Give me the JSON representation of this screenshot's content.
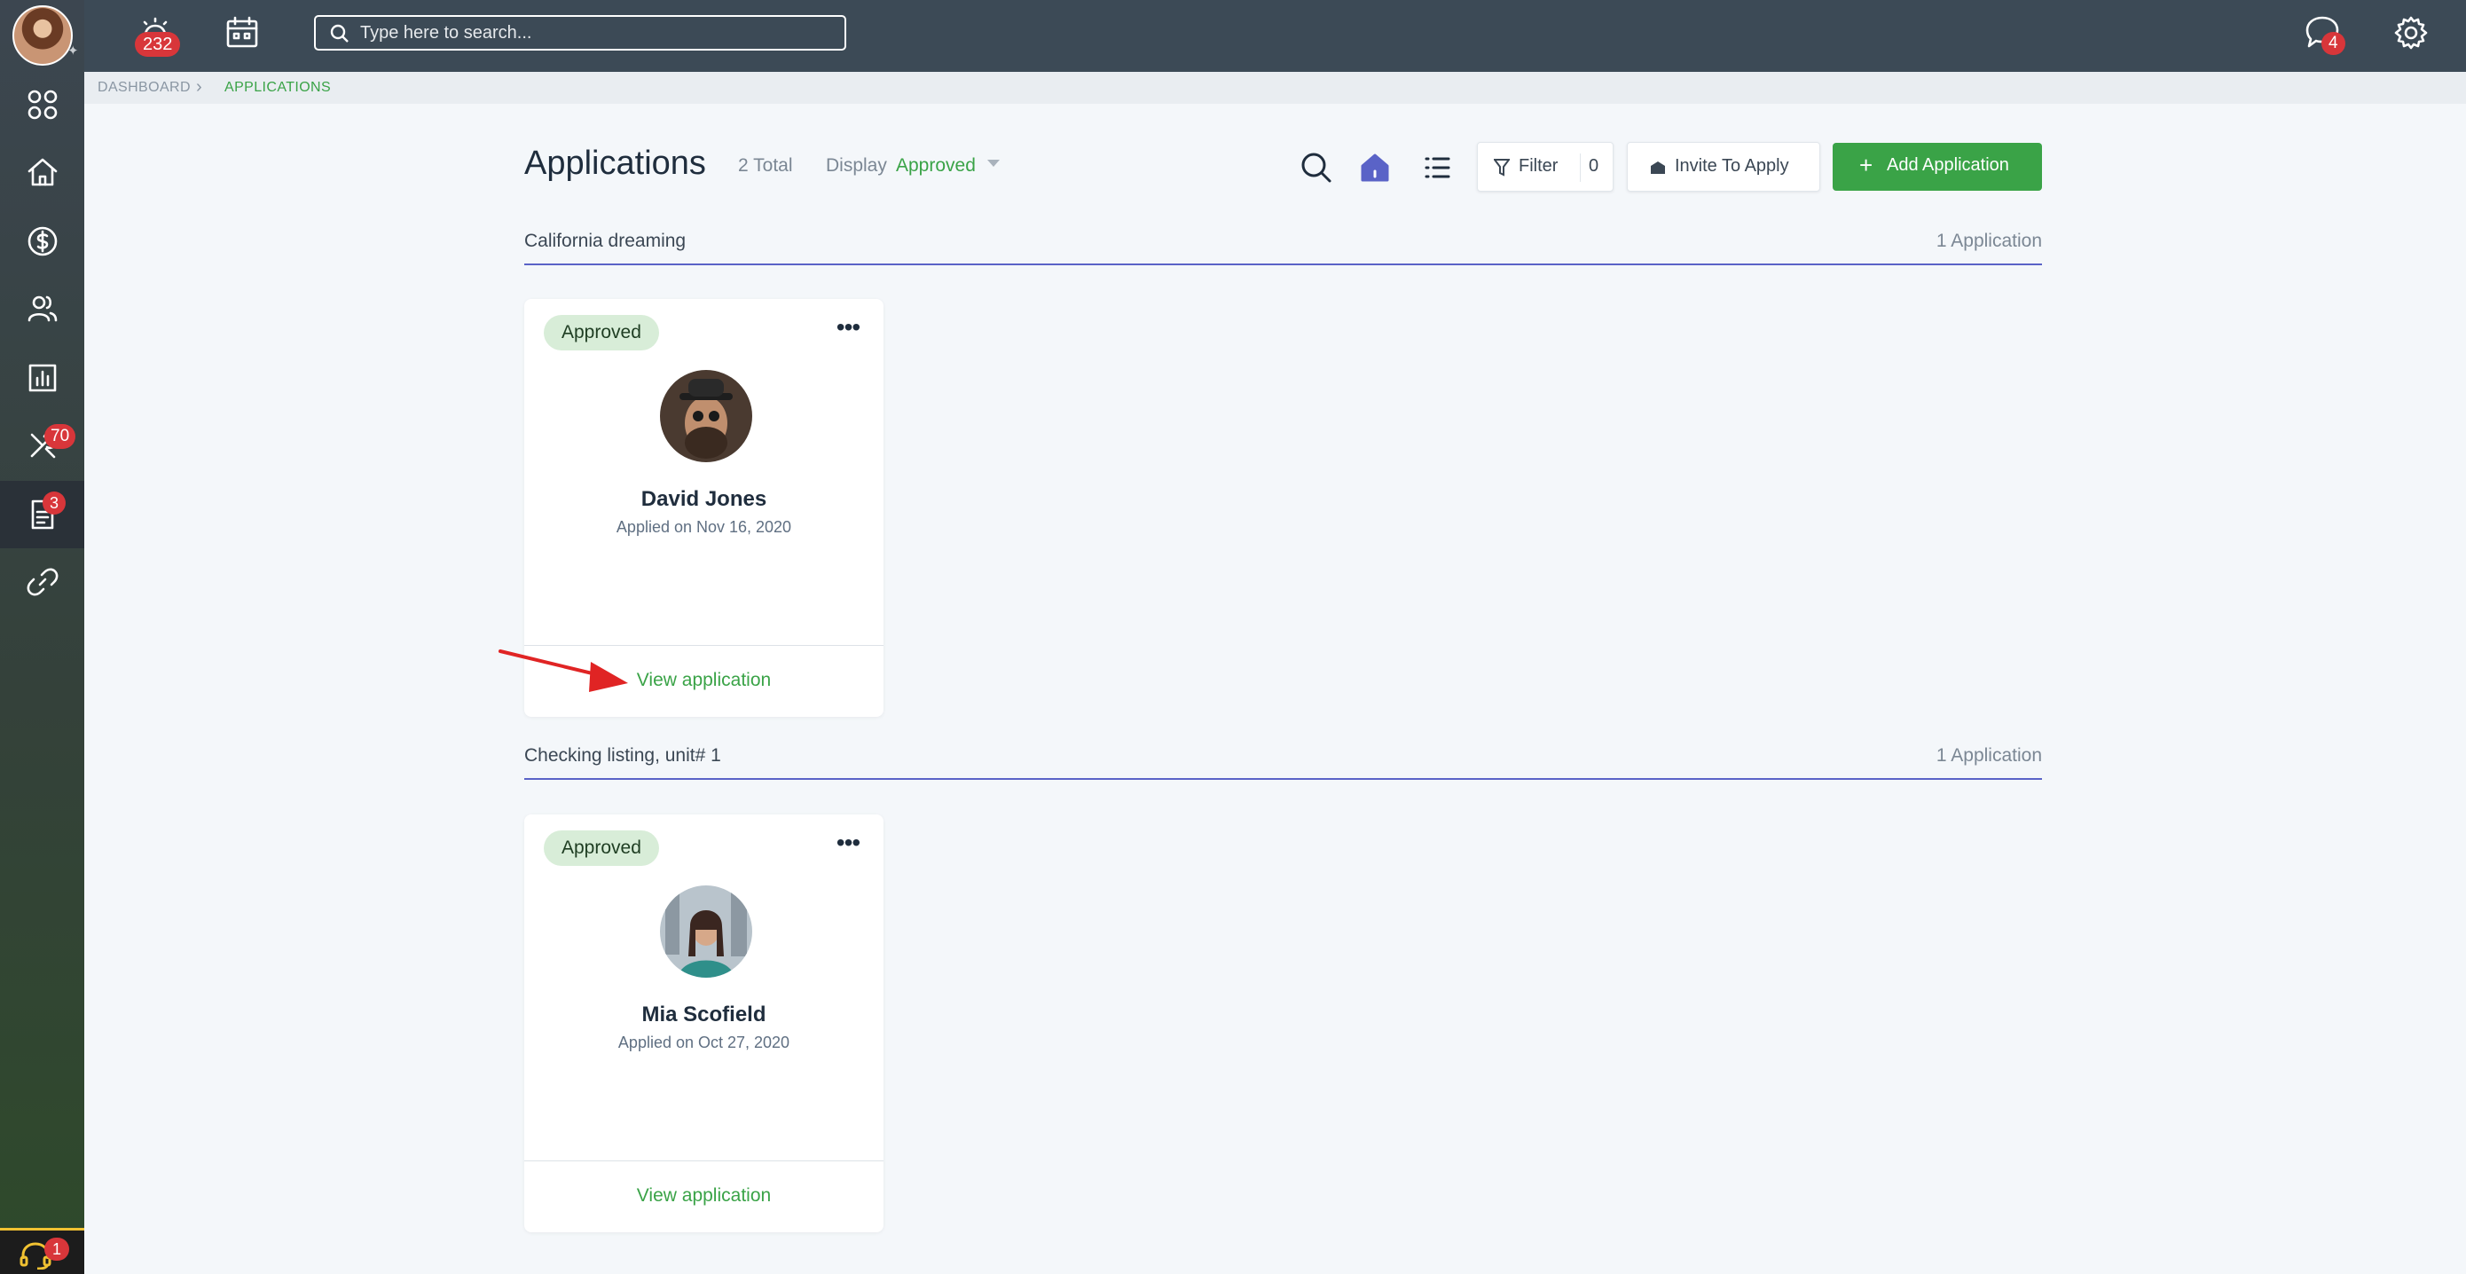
{
  "topbar": {
    "alerts_badge": "232",
    "search_placeholder": "Type here to search...",
    "messages_badge": "4"
  },
  "sidebar": {
    "badges": {
      "maintenance": "70",
      "applications": "3",
      "support": "1"
    }
  },
  "breadcrumb": {
    "dashboard": "DASHBOARD",
    "current": "APPLICATIONS"
  },
  "header": {
    "title": "Applications",
    "total": "2 Total",
    "display_label": "Display",
    "display_value": "Approved",
    "filter_label": "Filter",
    "filter_count": "0",
    "invite_label": "Invite To Apply",
    "add_label": "Add Application"
  },
  "groups": [
    {
      "title": "California dreaming",
      "count": "1 Application",
      "card": {
        "status": "Approved",
        "name": "David Jones",
        "applied": "Applied on Nov 16, 2020",
        "link": "View application"
      }
    },
    {
      "title": "Checking listing, unit# 1",
      "count": "1 Application",
      "card": {
        "status": "Approved",
        "name": "Mia Scofield",
        "applied": "Applied on Oct 27, 2020",
        "link": "View application"
      }
    }
  ],
  "colors": {
    "accent_green": "#3aa347",
    "topbar": "#3c4a56",
    "divider_blue": "#5a63c7",
    "badge_red": "#d8363a",
    "annotation_arrow": "#e02424"
  }
}
